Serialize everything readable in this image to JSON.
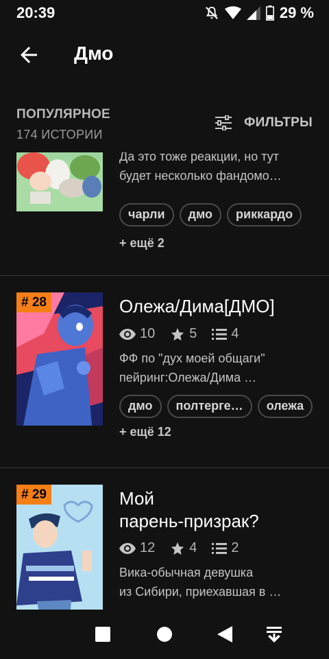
{
  "status_bar": {
    "time": "20:39",
    "battery": "29 %",
    "icons": [
      "mute-icon",
      "wifi-icon",
      "signal-icon",
      "battery-icon"
    ]
  },
  "app_bar": {
    "title": "Дмо",
    "back_icon": "arrow-left-icon"
  },
  "section": {
    "title": "ПОПУЛЯРНОЕ",
    "count": "174 ИСТОРИИ",
    "filters_label": "ФИЛЬТРЫ",
    "filters_icon": "sliders-icon"
  },
  "stories": [
    {
      "rank": "",
      "title": "",
      "desc_line1": "Да это тоже реакции, но тут",
      "desc_line2": "будет несколько фандомо…",
      "tags": [
        "чарли",
        "дмо",
        "риккардо"
      ],
      "more": "+ ещё 2"
    },
    {
      "rank": "# 28",
      "title": "Олежа/Дима[ДМО]",
      "views": "10",
      "stars": "5",
      "parts": "4",
      "desc_line1": "ФФ по \"дух моей общаги\"",
      "desc_line2": "пейринг:Олежа/Дима …",
      "tags": [
        "дмо",
        "полтерге…",
        "олежа"
      ],
      "more": "+ ещё 12"
    },
    {
      "rank": "# 29",
      "title_line1": "Мой",
      "title_line2": "парень-призрак?",
      "views": "12",
      "stars": "4",
      "parts": "2",
      "desc_line1": "Вика-обычная девушка",
      "desc_line2": "из Сибири, приехавшая в …"
    }
  ],
  "colors": {
    "background": "#121212",
    "rank_badge": "#f57f17",
    "tag_border": "#4a4a4a",
    "secondary_text": "#b4b4b4"
  },
  "nav_bar": {
    "buttons": [
      "square-icon",
      "circle-icon",
      "back-triangle-icon",
      "notification-down-icon"
    ]
  }
}
